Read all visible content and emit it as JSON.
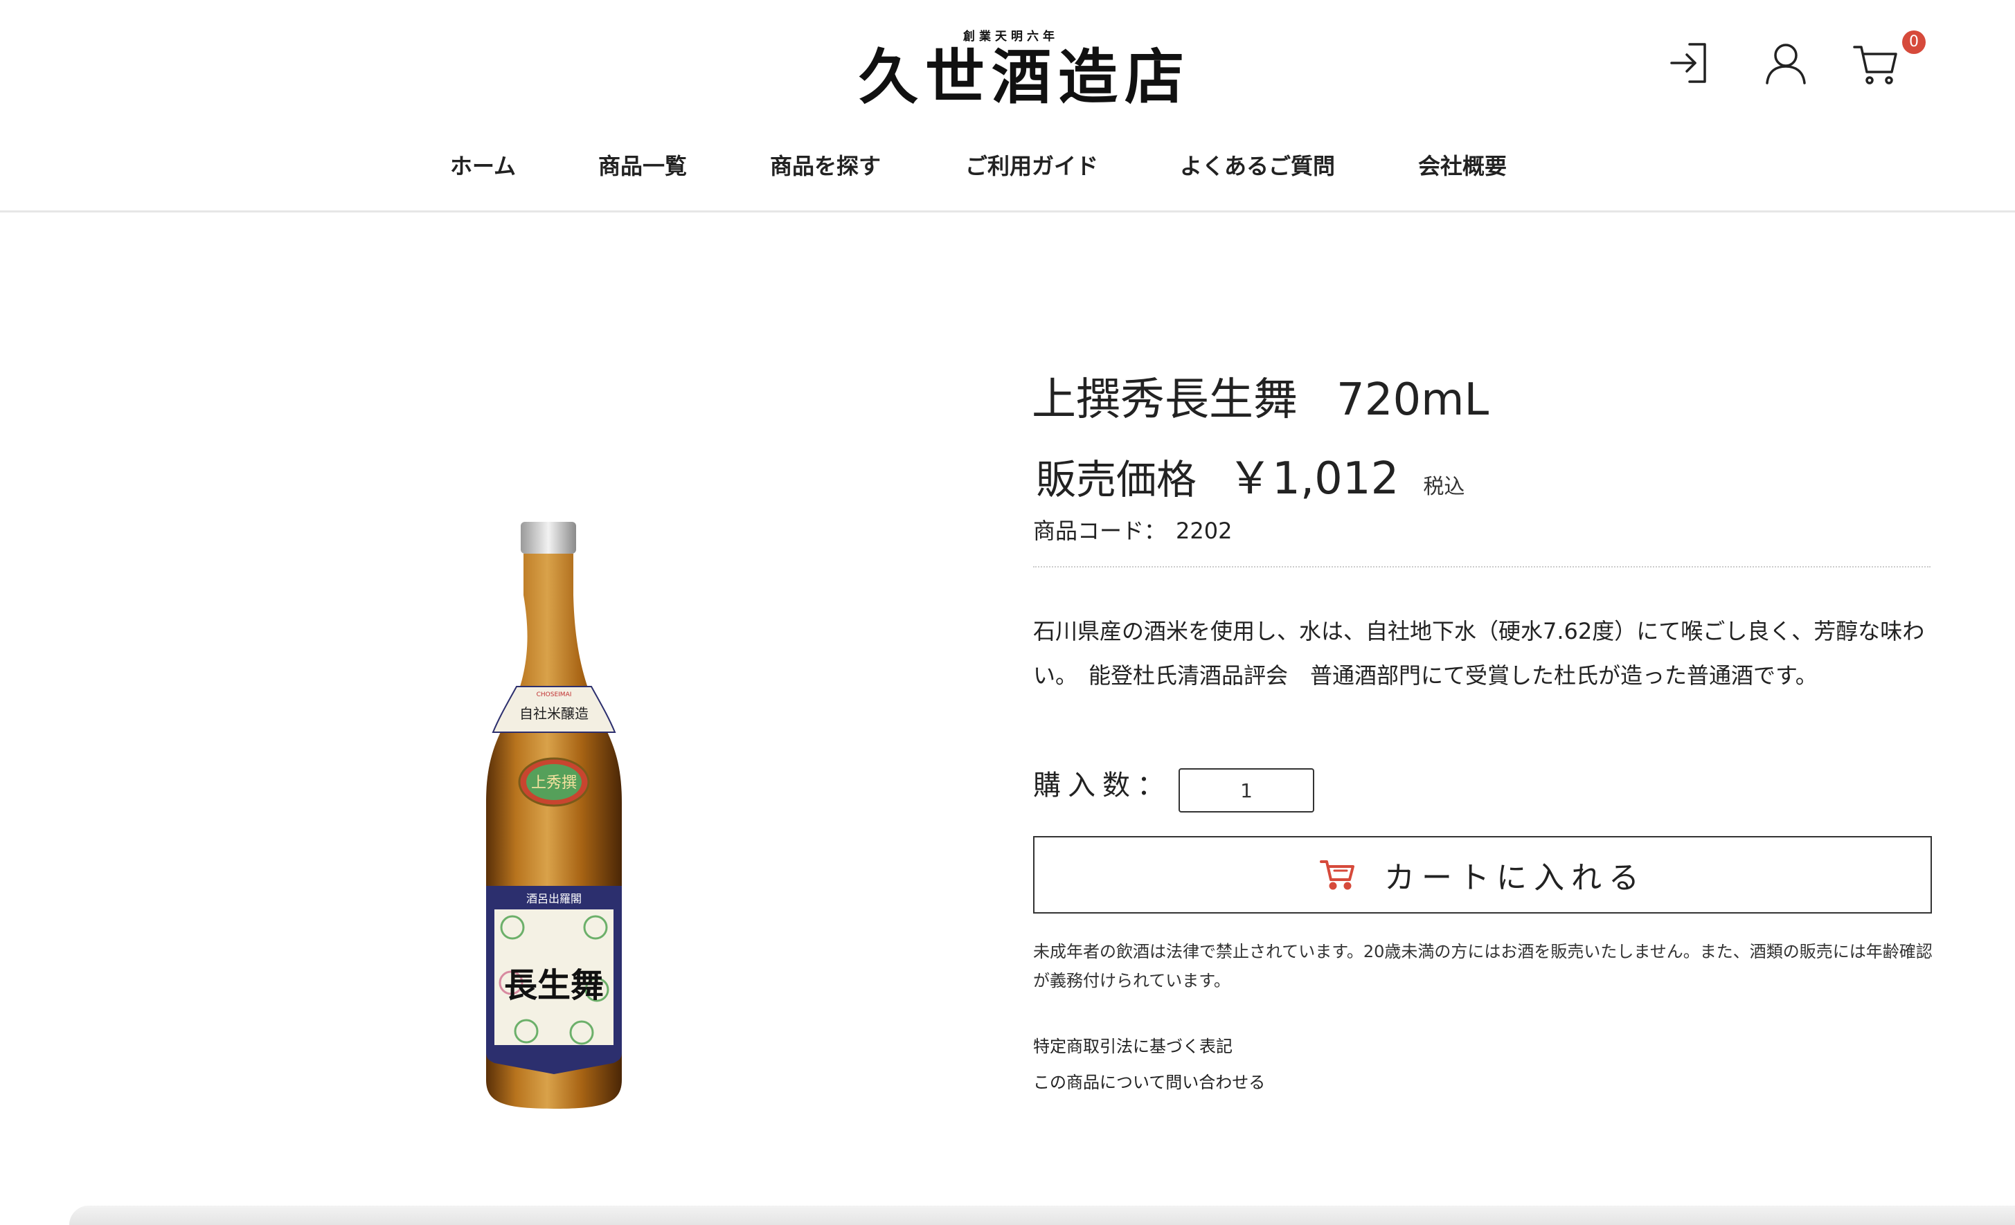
{
  "header": {
    "logo_tagline": "創業天明六年",
    "logo_name": "久世酒造店",
    "icons": {
      "login": "login-icon",
      "account": "user-icon",
      "cart": "cart-icon"
    },
    "cart_count": "0",
    "badge_color": "#d64a3b"
  },
  "nav": {
    "items": [
      {
        "label": "ホーム"
      },
      {
        "label": "商品一覧"
      },
      {
        "label": "商品を探す"
      },
      {
        "label": "ご利用ガイド"
      },
      {
        "label": "よくあるご質問"
      },
      {
        "label": "会社概要"
      }
    ]
  },
  "product": {
    "name": "上撰秀長生舞",
    "volume": "720mL",
    "price_label": "販売価格",
    "price": "￥1,012",
    "tax_label": "税込",
    "code_label": "商品コード：",
    "code": "2202",
    "description": "石川県産の酒米を使用し、水は、自社地下水（硬水7.62度）にて喉ごし良く、芳醇な味わい。　能登杜氏清酒品評会　普通酒部門にて受賞した杜氏が造った普通酒です。",
    "quantity_label": "購入数：",
    "quantity_value": "1",
    "add_to_cart_label": "カートに入れる",
    "cart_icon_color": "#d64a3b",
    "notice": "未成年者の飲酒は法律で禁止されています。20歳未満の方にはお酒を販売いたしません。また、酒類の販売には年齢確認が義務付けられています。",
    "legal_link": "特定商取引法に基づく表記",
    "inquiry_link": "この商品について問い合わせる",
    "bottle_label": {
      "brand": "長生舞",
      "grade": "上秀撰",
      "romaji": "CHOSEIMAI",
      "band": "自社米醸造",
      "shoulder": "酒呂出羅閣"
    }
  }
}
